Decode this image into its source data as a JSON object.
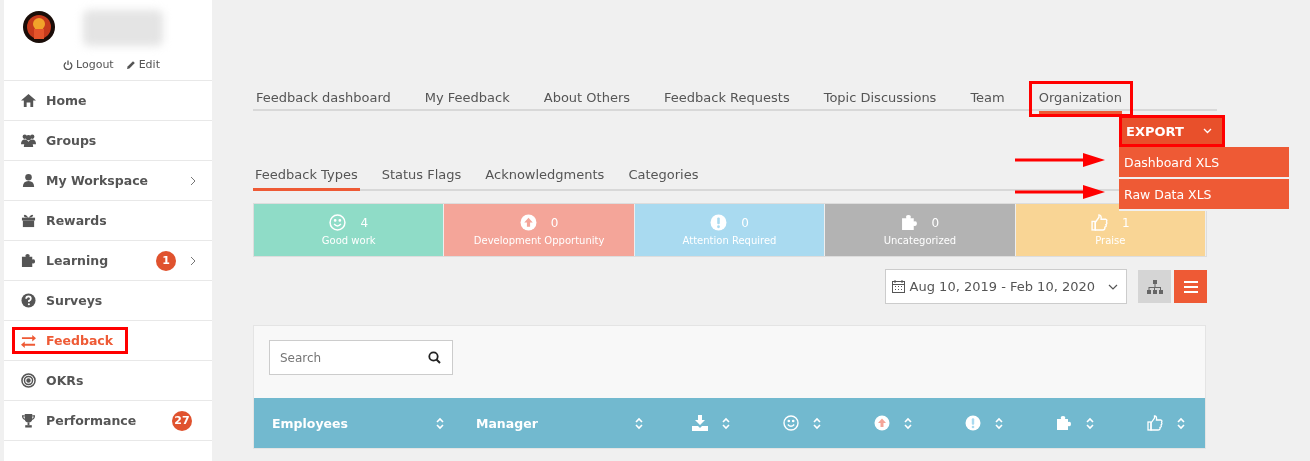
{
  "user": {
    "actions": [
      {
        "label": "Logout"
      },
      {
        "label": "Edit"
      }
    ]
  },
  "sidebar": {
    "items": [
      {
        "label": "Home",
        "selected": false,
        "highlighted": false,
        "submenu": false
      },
      {
        "label": "Groups",
        "selected": false,
        "highlighted": false,
        "submenu": false
      },
      {
        "label": "My Workspace",
        "selected": false,
        "highlighted": false,
        "submenu": true
      },
      {
        "label": "Rewards",
        "selected": false,
        "highlighted": false,
        "submenu": false
      },
      {
        "label": "Learning",
        "selected": false,
        "highlighted": false,
        "submenu": true,
        "badge": "1"
      },
      {
        "label": "Surveys",
        "selected": false,
        "highlighted": false,
        "submenu": false
      },
      {
        "label": "Feedback",
        "selected": true,
        "highlighted": true,
        "submenu": false
      },
      {
        "label": "OKRs",
        "selected": false,
        "highlighted": false,
        "submenu": false
      },
      {
        "label": "Performance",
        "selected": false,
        "highlighted": false,
        "submenu": false,
        "badge": "27"
      }
    ]
  },
  "tabs": [
    {
      "label": "Feedback dashboard",
      "selected": false,
      "highlighted": false
    },
    {
      "label": "My Feedback",
      "selected": false,
      "highlighted": false
    },
    {
      "label": "About Others",
      "selected": false,
      "highlighted": false
    },
    {
      "label": "Feedback Requests",
      "selected": false,
      "highlighted": false
    },
    {
      "label": "Topic Discussions",
      "selected": false,
      "highlighted": false
    },
    {
      "label": "Team",
      "selected": false,
      "highlighted": false
    },
    {
      "label": "Organization",
      "selected": true,
      "highlighted": true
    }
  ],
  "export": {
    "label": "EXPORT",
    "highlighted": true,
    "expanded": true,
    "options": [
      {
        "label": "Dashboard XLS",
        "arrow": true
      },
      {
        "label": "Raw Data XLS",
        "arrow": true
      }
    ]
  },
  "subtabs": [
    {
      "label": "Feedback Types",
      "selected": true
    },
    {
      "label": "Status Flags",
      "selected": false
    },
    {
      "label": "Acknowledgments",
      "selected": false
    },
    {
      "label": "Categories",
      "selected": false
    }
  ],
  "stats": [
    {
      "count": "4",
      "label": "Good work",
      "color": "#8fdcc7"
    },
    {
      "count": "0",
      "label": "Development Opportunity",
      "color": "#f4a599"
    },
    {
      "count": "0",
      "label": "Attention Required",
      "color": "#a9daf0"
    },
    {
      "count": "0",
      "label": "Uncategorized",
      "color": "#b3b3b3"
    },
    {
      "count": "1",
      "label": "Praise",
      "color": "#f9d595"
    }
  ],
  "date_range": "Aug 10, 2019 - Feb 10, 2020",
  "view_toggle": [
    {
      "selected": false
    },
    {
      "selected": true
    }
  ],
  "table": {
    "search": {
      "placeholder": "Search"
    },
    "columns": [
      {
        "kind": "text",
        "label": "Employees"
      },
      {
        "kind": "text",
        "label": "Manager"
      },
      {
        "kind": "icon"
      },
      {
        "kind": "icon"
      },
      {
        "kind": "icon"
      },
      {
        "kind": "icon"
      },
      {
        "kind": "icon"
      },
      {
        "kind": "icon"
      }
    ]
  }
}
